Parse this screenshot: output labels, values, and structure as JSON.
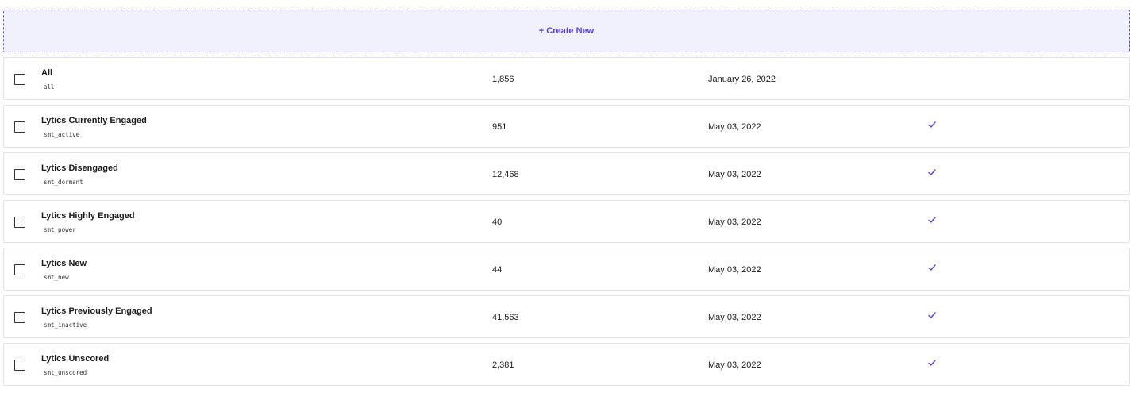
{
  "create_new": {
    "label": "+ Create New"
  },
  "colors": {
    "accent": "#5b3fd9",
    "create_bg": "#f1f0fd",
    "row_border": "#e3e3e3",
    "text": "#1c1c1c"
  },
  "rows": [
    {
      "name": "All",
      "slug": "all",
      "count": "1,856",
      "date": "January 26, 2022",
      "checked": false,
      "check_icon": "none"
    },
    {
      "name": "Lytics Currently Engaged",
      "slug": "smt_active",
      "count": "951",
      "date": "May 03, 2022",
      "checked": true,
      "check_icon": "checkmark-icon"
    },
    {
      "name": "Lytics Disengaged",
      "slug": "smt_dormant",
      "count": "12,468",
      "date": "May 03, 2022",
      "checked": true,
      "check_icon": "checkmark-icon"
    },
    {
      "name": "Lytics Highly Engaged",
      "slug": "smt_power",
      "count": "40",
      "date": "May 03, 2022",
      "checked": true,
      "check_icon": "checkmark-icon"
    },
    {
      "name": "Lytics New",
      "slug": "smt_new",
      "count": "44",
      "date": "May 03, 2022",
      "checked": true,
      "check_icon": "checkmark-icon"
    },
    {
      "name": "Lytics Previously Engaged",
      "slug": "smt_inactive",
      "count": "41,563",
      "date": "May 03, 2022",
      "checked": true,
      "check_icon": "checkmark-icon"
    },
    {
      "name": "Lytics Unscored",
      "slug": "smt_unscored",
      "count": "2,381",
      "date": "May 03, 2022",
      "checked": true,
      "check_icon": "checkmark-icon"
    }
  ]
}
